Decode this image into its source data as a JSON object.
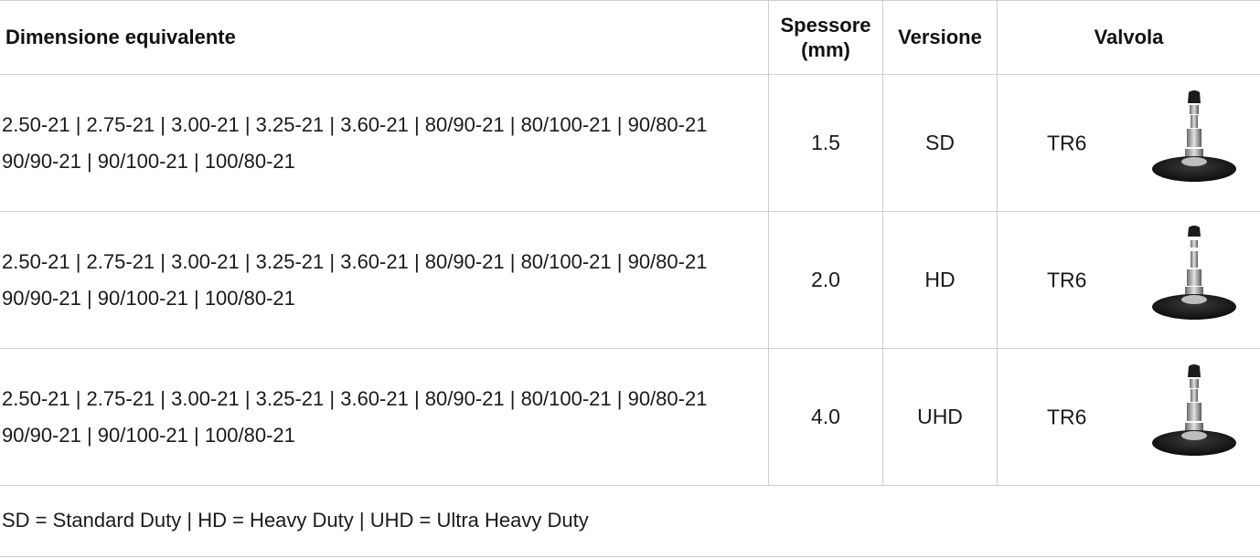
{
  "header": {
    "col_size": "Dimensione equivalente",
    "col_thickness_line1": "Spessore",
    "col_thickness_line2": "(mm)",
    "col_version": "Versione",
    "col_valve": "Valvola"
  },
  "rows": [
    {
      "sizes_line1": "2.50-21 | 2.75-21 | 3.00-21 | 3.25-21 | 3.60-21 | 80/90-21 | 80/100-21 | 90/80-21",
      "sizes_line2": "90/90-21 | 90/100-21 | 100/80-21",
      "thickness": "1.5",
      "version": "SD",
      "valve": "TR6",
      "valve_icon": "valve-image"
    },
    {
      "sizes_line1": "2.50-21 | 2.75-21 | 3.00-21 | 3.25-21 | 3.60-21 | 80/90-21 | 80/100-21 | 90/80-21",
      "sizes_line2": "90/90-21 | 90/100-21 | 100/80-21",
      "thickness": "2.0",
      "version": "HD",
      "valve": "TR6",
      "valve_icon": "valve-image"
    },
    {
      "sizes_line1": "2.50-21 | 2.75-21 | 3.00-21 | 3.25-21 | 3.60-21 | 80/90-21 | 80/100-21 | 90/80-21",
      "sizes_line2": "90/90-21 | 90/100-21 | 100/80-21",
      "thickness": "4.0",
      "version": "UHD",
      "valve": "TR6",
      "valve_icon": "valve-image"
    }
  ],
  "footer": {
    "legend": "SD = Standard Duty | HD = Heavy Duty | UHD = Ultra Heavy Duty"
  }
}
